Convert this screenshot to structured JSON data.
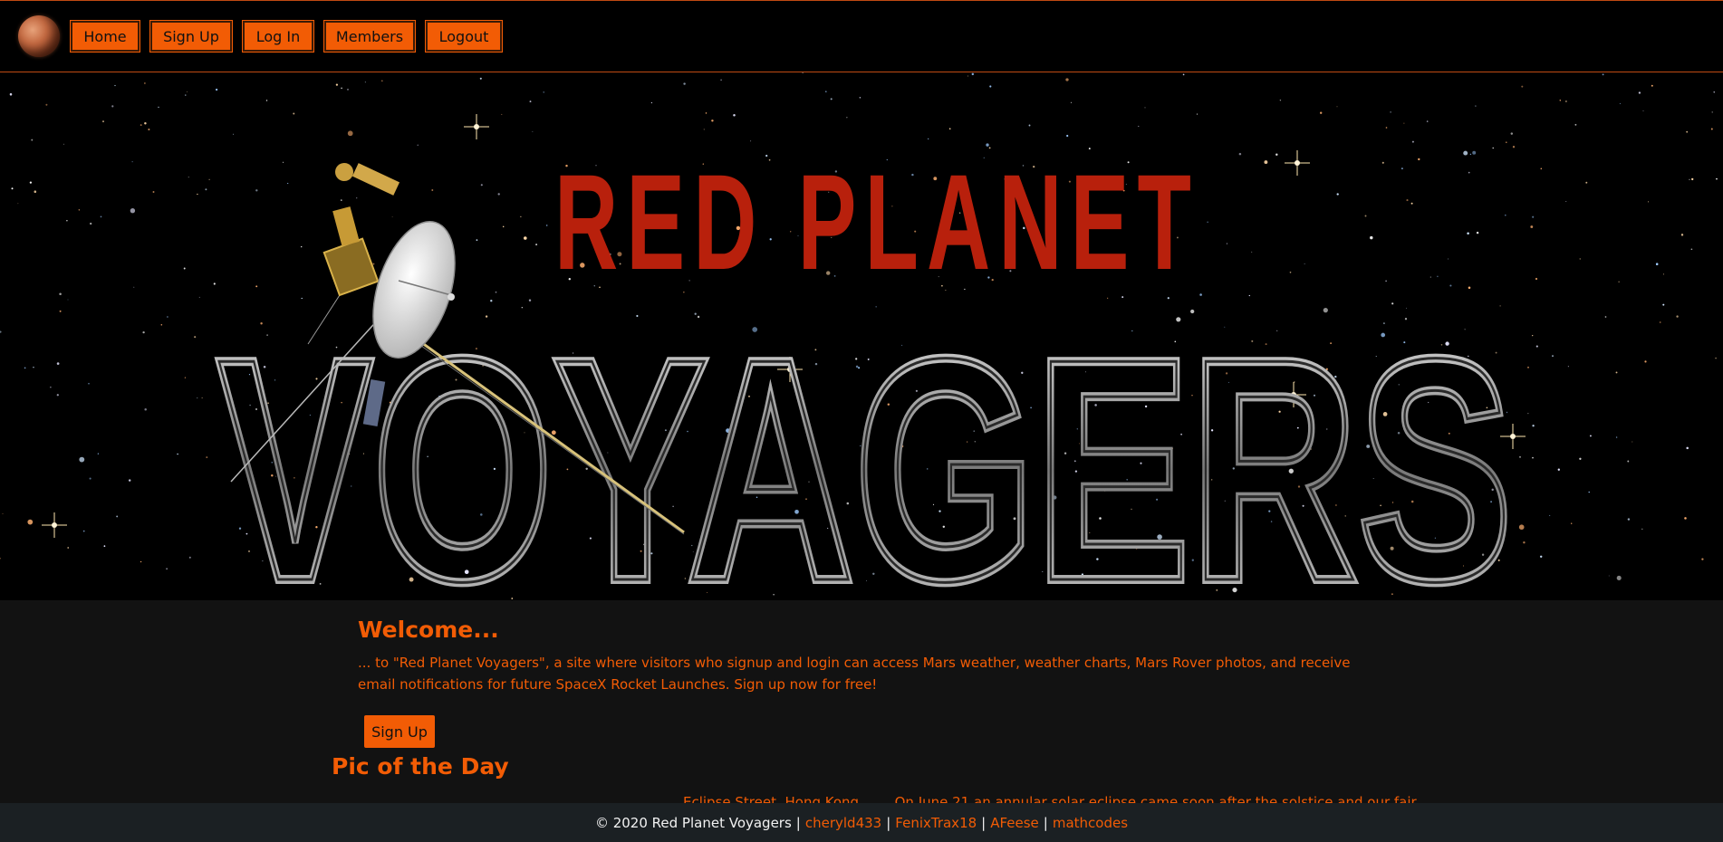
{
  "nav": {
    "logo": "mars-planet-icon",
    "items": [
      {
        "label": "Home"
      },
      {
        "label": "Sign Up"
      },
      {
        "label": "Log In"
      },
      {
        "label": "Members"
      },
      {
        "label": "Logout"
      }
    ]
  },
  "hero": {
    "title_top": "RED PLANET",
    "title_bottom": "VOYAGERS",
    "spacecraft": "voyager-probe-illustration"
  },
  "welcome": {
    "title": "Welcome...",
    "text": "... to \"Red Planet Voyagers\", a site where visitors who signup and login can access Mars weather, weather charts, Mars Rover photos, and receive email notifications for future SpaceX Rocket Launches. Sign up now for free!",
    "signup_label": "Sign Up"
  },
  "pic_of_day": {
    "title": "Pic of the Day",
    "caption_title": "Eclipse Street, Hong Kong",
    "caption_text": "On June 21 an annular solar eclipse came soon after the solstice and our fair"
  },
  "footer": {
    "copyright": "© 2020 Red Planet Voyagers",
    "links": [
      "cheryld433",
      "FenixTrax18",
      "AFeese",
      "mathcodes"
    ]
  },
  "colors": {
    "accent": "#f25c05",
    "hero_red": "#b8200c",
    "nav_bg": "#000000",
    "content_bg": "#121212",
    "footer_bg": "#1b2023"
  }
}
